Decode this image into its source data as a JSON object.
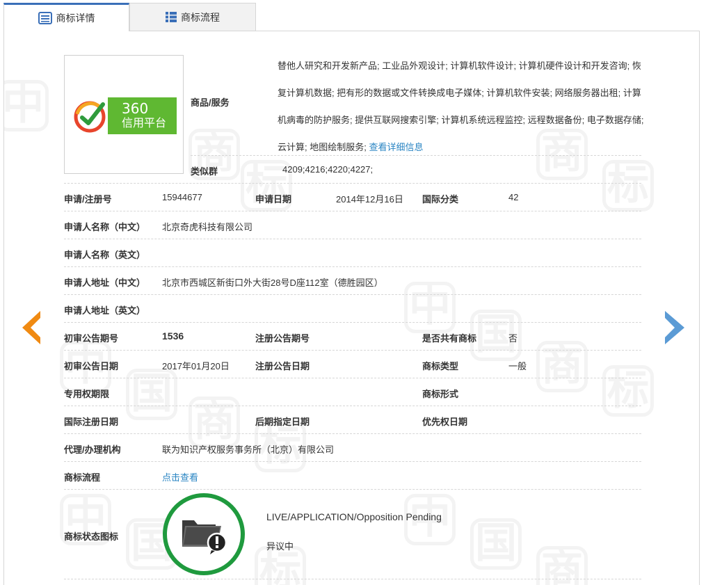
{
  "tabs": [
    {
      "label": "商标详情",
      "active": true
    },
    {
      "label": "商标流程",
      "active": false
    }
  ],
  "logo": {
    "number": "360",
    "text": "信用平台",
    "color": "#5fb832"
  },
  "goods": {
    "label": "商品/服务",
    "text": "替他人研究和开发新产品; 工业品外观设计; 计算机软件设计; 计算机硬件设计和开发咨询; 恢复计算机数据; 把有形的数据或文件转换成电子媒体; 计算机软件安装; 网络服务器出租; 计算机病毒的防护服务; 提供互联网搜索引擎; 计算机系统远程监控; 远程数据备份; 电子数据存储; 云计算; 地图绘制服务; ",
    "more_link": "查看详细信息"
  },
  "similar_group": {
    "label": "类似群",
    "value": "4209;4216;4220;4227;"
  },
  "fields": {
    "reg_no": {
      "label": "申请/注册号",
      "value": "15944677"
    },
    "apply_date": {
      "label": "申请日期",
      "value": "2014年12月16日"
    },
    "intl_class": {
      "label": "国际分类",
      "value": "42"
    },
    "applicant_cn": {
      "label": "申请人名称（中文）",
      "value": "北京奇虎科技有限公司"
    },
    "applicant_en": {
      "label": "申请人名称（英文）",
      "value": ""
    },
    "address_cn": {
      "label": "申请人地址（中文）",
      "value": "北京市西城区新街口外大街28号D座112室（德胜园区）"
    },
    "address_en": {
      "label": "申请人地址（英文）",
      "value": ""
    },
    "prelim_issue": {
      "label": "初审公告期号",
      "value": "1536"
    },
    "reg_issue": {
      "label": "注册公告期号",
      "value": ""
    },
    "shared": {
      "label": "是否共有商标",
      "value": "否"
    },
    "prelim_date": {
      "label": "初审公告日期",
      "value": "2017年01月20日"
    },
    "reg_date": {
      "label": "注册公告日期",
      "value": ""
    },
    "tm_type": {
      "label": "商标类型",
      "value": "一般"
    },
    "exclusive": {
      "label": "专用权期限",
      "value": ""
    },
    "tm_form": {
      "label": "商标形式",
      "value": ""
    },
    "intl_reg_date": {
      "label": "国际注册日期",
      "value": ""
    },
    "later_date": {
      "label": "后期指定日期",
      "value": ""
    },
    "priority_date": {
      "label": "优先权日期",
      "value": ""
    },
    "agent": {
      "label": "代理/办理机构",
      "value": "联为知识产权服务事务所（北京）有限公司"
    },
    "process": {
      "label": "商标流程",
      "value": "点击查看"
    },
    "status_icon": {
      "label": "商标状态图标"
    }
  },
  "status": {
    "en": "LIVE/APPLICATION/Opposition Pending",
    "cn": "异议中",
    "ring_color": "#1f9a3e"
  },
  "watermark": {
    "chars": [
      "中",
      "国",
      "商",
      "标"
    ]
  },
  "colors": {
    "accent": "#3a6fb8",
    "link": "#2a85c3",
    "prev_arrow": "#f08a12",
    "next_arrow": "#5b9bd5"
  }
}
